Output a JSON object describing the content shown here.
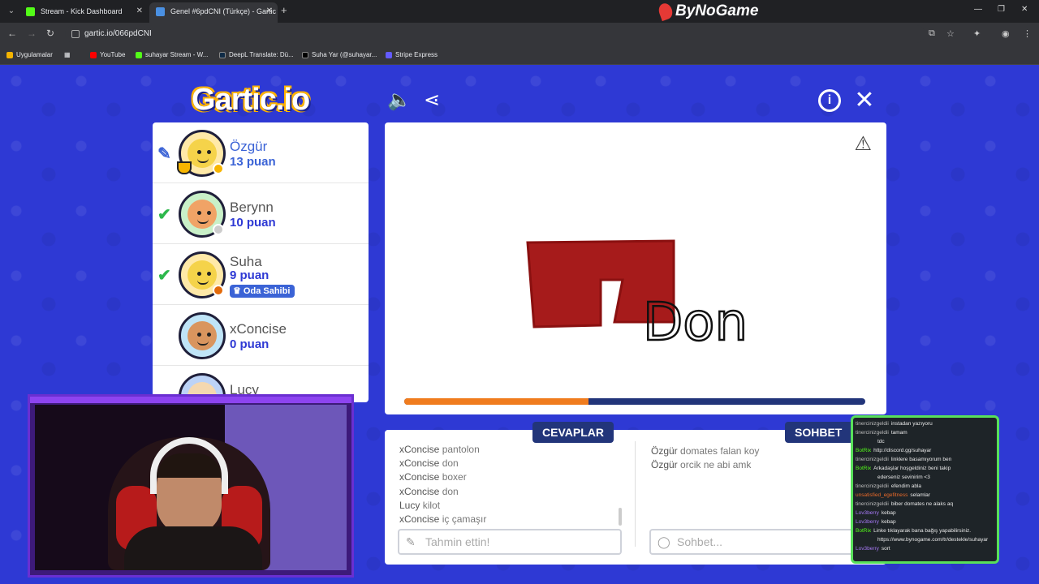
{
  "browser": {
    "tabs": [
      {
        "title": "Stream - Kick Dashboard",
        "favicon_color": "#53fc18"
      },
      {
        "title": "Genel #6pdCNI (Türkçe) - Gartic",
        "favicon_color": "#4a90e2"
      }
    ],
    "brand": "ByNoGame",
    "url": "gartic.io/066pdCNI",
    "bookmarks": [
      {
        "label": "Uygulamalar",
        "color": "#f4b400"
      },
      {
        "label": "YouTube",
        "color": "#ff0000"
      },
      {
        "label": "suhayar Stream - W...",
        "color": "#53fc18"
      },
      {
        "label": "DeepL Translate: Dü...",
        "color": "#0f2b46"
      },
      {
        "label": "Suha Yar (@suhayar...",
        "color": "#000000"
      },
      {
        "label": "Stripe Express",
        "color": "#635bff"
      }
    ]
  },
  "game": {
    "logo": "Gartic.io",
    "players": [
      {
        "name": "Özgür",
        "score": "13 puan",
        "mark": "pen",
        "face": "#f5d34a",
        "status": "#f7b500",
        "trophy": true
      },
      {
        "name": "Berynn",
        "score": "10 puan",
        "mark": "check",
        "face": "#f0a366",
        "status": "#cccccc"
      },
      {
        "name": "Suha",
        "score": "9 puan",
        "mark": "check",
        "face": "#f5d34a",
        "status": "#e36a0a",
        "badge": "Oda Sahibi"
      },
      {
        "name": "xConcise",
        "score": "0 puan",
        "mark": "",
        "face": "#d9955e",
        "status": ""
      },
      {
        "name": "Lucy",
        "score": "",
        "mark": "",
        "face": "#f4d8b0",
        "status": ""
      }
    ],
    "canvas": {
      "drawing_text": "Don",
      "progress": 0.4,
      "fill_color": "#a61b1b"
    },
    "answers_tab": "CEVAPLAR",
    "chat_tab": "SOHBET",
    "answers": [
      {
        "user": "xConcise",
        "text": "pantolon"
      },
      {
        "user": "xConcise",
        "text": "don"
      },
      {
        "user": "xConcise",
        "text": "boxer"
      },
      {
        "user": "xConcise",
        "text": "don"
      },
      {
        "user": "Lucy",
        "text": "kilot"
      },
      {
        "user": "xConcise",
        "text": "iç çamaşır"
      }
    ],
    "chat": [
      {
        "user": "Özgür",
        "text": "domates falan koy"
      },
      {
        "user": "Özgür",
        "text": "orcik ne abi amk"
      }
    ],
    "answer_placeholder": "Tahmin ettin!",
    "chat_placeholder": "Sohbet..."
  },
  "stream_chat": [
    {
      "user": "tinercinizgeldii",
      "text": "instadan yazıyoru",
      "color": "#bdbdbd"
    },
    {
      "user": "tinercinizgeldii",
      "text": "tamam",
      "color": "#bdbdbd"
    },
    {
      "user": "",
      "text": "tdc",
      "color": "#bdbdbd"
    },
    {
      "user": "BotRix",
      "text": "http://discord.gg/suhayar",
      "color": "#53fc18"
    },
    {
      "user": "tinercinizgeldii",
      "text": "linklere basamıyorum ben",
      "color": "#bdbdbd"
    },
    {
      "user": "BotRix",
      "text": "Arkadaşlar hoşgeldiniz beni takip",
      "color": "#53fc18"
    },
    {
      "user": "",
      "text": "ederseniz sevinirim <3",
      "color": "#bdbdbd"
    },
    {
      "user": "tinercinizgeldii",
      "text": "efendim abla",
      "color": "#bdbdbd"
    },
    {
      "user": "unsatisfied_egefitness",
      "text": "selamlar",
      "color": "#e96a2a"
    },
    {
      "user": "tinercinizgeldii",
      "text": "biber domates ne alaks aq",
      "color": "#bdbdbd"
    },
    {
      "user": "Lov3berry",
      "text": "kebap",
      "color": "#a678f5"
    },
    {
      "user": "Lov3berry",
      "text": "kebap",
      "color": "#a678f5"
    },
    {
      "user": "BotRix",
      "text": "Linke tıklayarak bana bağış yapabilirsiniz.",
      "color": "#53fc18"
    },
    {
      "user": "",
      "text": "https://www.bynogame.com/tr/destekle/suhayar",
      "color": "#bdbdbd"
    },
    {
      "user": "Lov3berry",
      "text": "sort",
      "color": "#a678f5"
    }
  ]
}
